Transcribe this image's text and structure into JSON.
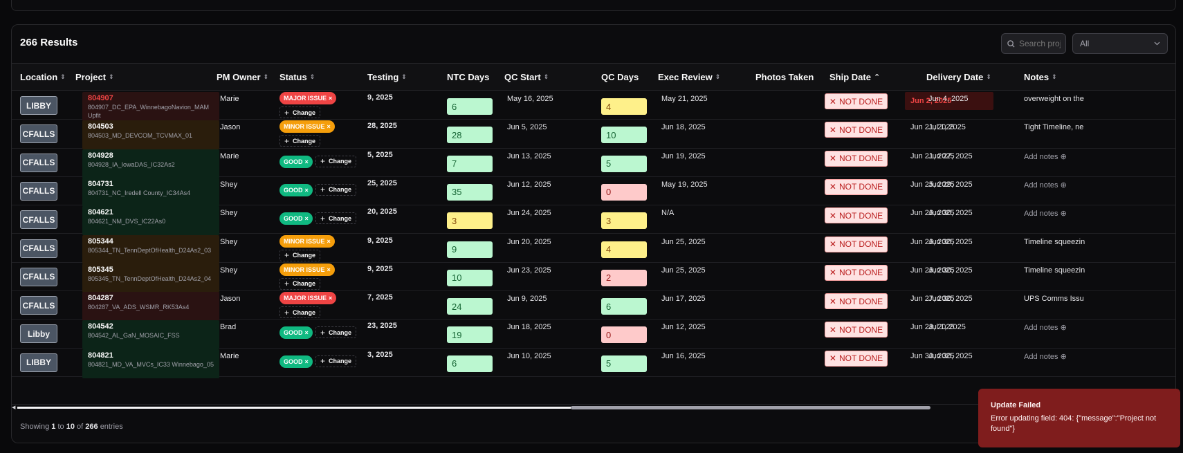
{
  "results_label": "266 Results",
  "search": {
    "placeholder": "Search projects"
  },
  "filter": {
    "value": "All"
  },
  "columns": [
    {
      "label": "Location",
      "sortable": true
    },
    {
      "label": "Project",
      "sortable": true
    },
    {
      "label": "PM Owner",
      "sortable": true
    },
    {
      "label": "Status",
      "sortable": true
    },
    {
      "label": "Testing",
      "sortable": true
    },
    {
      "label": "NTC Days",
      "sortable": false
    },
    {
      "label": "QC Start",
      "sortable": true
    },
    {
      "label": "QC Days",
      "sortable": false
    },
    {
      "label": "Exec Review",
      "sortable": true
    },
    {
      "label": "Photos Taken",
      "sortable": false
    },
    {
      "label": "Ship Date",
      "sortable": true,
      "sorted": "asc"
    },
    {
      "label": "Delivery Date",
      "sortable": true
    },
    {
      "label": "Notes",
      "sortable": true
    }
  ],
  "change_label": "Change",
  "not_done_label": "NOT DONE",
  "add_notes_label": "Add notes",
  "rows": [
    {
      "location": "LIBBY",
      "project_id": "804907",
      "project_name": "804907_DC_EPA_WinnebagoNavion_MAM Upfit",
      "pm": "Marie",
      "status": "MAJOR ISSUE",
      "status_type": "major",
      "testing": "9, 2025",
      "ntc_days": "6",
      "ntc_color": "green",
      "qc_start": "May 16, 2025",
      "qc_days": "4",
      "qc_color": "yellow",
      "exec_review": "May 21, 2025",
      "photos": "NOT DONE",
      "ship_date": "Jun 2, 2025",
      "ship_highlight": true,
      "delivery_date": "Jun 4, 2025",
      "notes": "overweight on the",
      "notes_empty": false
    },
    {
      "location": "CFALLS",
      "project_id": "804503",
      "project_name": "804503_MD_DEVCOM_TCVMAX_01",
      "pm": "Jason",
      "status": "MINOR ISSUE",
      "status_type": "minor",
      "testing": "28, 2025",
      "ntc_days": "28",
      "ntc_color": "green",
      "qc_start": "Jun 5, 2025",
      "qc_days": "10",
      "qc_color": "green",
      "exec_review": "Jun 18, 2025",
      "photos": "NOT DONE",
      "ship_date": "Jun 21, 2025",
      "ship_highlight": false,
      "delivery_date": "Jul 1, 2025",
      "notes": "Tight Timeline, ne",
      "notes_empty": false
    },
    {
      "location": "CFALLS",
      "project_id": "804928",
      "project_name": "804928_IA_IowaDAS_IC32As2",
      "pm": "Marie",
      "status": "GOOD",
      "status_type": "good",
      "testing": "5, 2025",
      "ntc_days": "7",
      "ntc_color": "green",
      "qc_start": "Jun 13, 2025",
      "qc_days": "5",
      "qc_color": "green",
      "exec_review": "Jun 19, 2025",
      "photos": "NOT DONE",
      "ship_date": "Jun 21, 2025",
      "ship_highlight": false,
      "delivery_date": "Jun 27, 2025",
      "notes": "Add notes",
      "notes_empty": true
    },
    {
      "location": "CFALLS",
      "project_id": "804731",
      "project_name": "804731_NC_Iredell County_IC34As4",
      "pm": "Shey",
      "status": "GOOD",
      "status_type": "good",
      "testing": "25, 2025",
      "ntc_days": "35",
      "ntc_color": "green",
      "qc_start": "Jun 12, 2025",
      "qc_days": "0",
      "qc_color": "red",
      "exec_review": "May 19, 2025",
      "photos": "NOT DONE",
      "ship_date": "Jun 25, 2025",
      "ship_highlight": false,
      "delivery_date": "Jun 29, 2025",
      "notes": "Add notes",
      "notes_empty": true
    },
    {
      "location": "CFALLS",
      "project_id": "804621",
      "project_name": "804621_NM_DVS_IC22As0",
      "pm": "Shey",
      "status": "GOOD",
      "status_type": "good",
      "testing": "20, 2025",
      "ntc_days": "3",
      "ntc_color": "yellow",
      "qc_start": "Jun 24, 2025",
      "qc_days": "3",
      "qc_color": "yellow",
      "exec_review": "N/A",
      "photos": "NOT DONE",
      "ship_date": "Jun 26, 2025",
      "ship_highlight": false,
      "delivery_date": "Jun 30, 2025",
      "notes": "Add notes",
      "notes_empty": true
    },
    {
      "location": "CFALLS",
      "project_id": "805344",
      "project_name": "805344_TN_TennDeptOfHealth_D24As2_03",
      "pm": "Shey",
      "status": "MINOR ISSUE",
      "status_type": "minor",
      "testing": "9, 2025",
      "ntc_days": "9",
      "ntc_color": "green",
      "qc_start": "Jun 20, 2025",
      "qc_days": "4",
      "qc_color": "yellow",
      "exec_review": "Jun 25, 2025",
      "photos": "NOT DONE",
      "ship_date": "Jun 26, 2025",
      "ship_highlight": false,
      "delivery_date": "Jun 30, 2025",
      "notes": "Timeline squeezin",
      "notes_empty": false
    },
    {
      "location": "CFALLS",
      "project_id": "805345",
      "project_name": "805345_TN_TennDeptOfHealth_D24As2_04",
      "pm": "Shey",
      "status": "MINOR ISSUE",
      "status_type": "minor",
      "testing": "9, 2025",
      "ntc_days": "10",
      "ntc_color": "green",
      "qc_start": "Jun 23, 2025",
      "qc_days": "2",
      "qc_color": "red",
      "exec_review": "Jun 25, 2025",
      "photos": "NOT DONE",
      "ship_date": "Jun 26, 2025",
      "ship_highlight": false,
      "delivery_date": "Jun 30, 2025",
      "notes": "Timeline squeezin",
      "notes_empty": false
    },
    {
      "location": "CFALLS",
      "project_id": "804287",
      "project_name": "804287_VA_ADS_WSMR_RK53As4",
      "pm": "Jason",
      "status": "MAJOR ISSUE",
      "status_type": "major",
      "testing": "7, 2025",
      "ntc_days": "24",
      "ntc_color": "green",
      "qc_start": "Jun 9, 2025",
      "qc_days": "6",
      "qc_color": "green",
      "exec_review": "Jun 17, 2025",
      "photos": "NOT DONE",
      "ship_date": "Jun 27, 2025",
      "ship_highlight": false,
      "delivery_date": "Jun 30, 2025",
      "notes": "UPS Comms Issu",
      "notes_empty": false
    },
    {
      "location": "Libby",
      "project_id": "804542",
      "project_name": "804542_AL_GaN_MOSAIC_FSS",
      "pm": "Brad",
      "status": "GOOD",
      "status_type": "good",
      "testing": "23, 2025",
      "ntc_days": "19",
      "ntc_color": "green",
      "qc_start": "Jun 18, 2025",
      "qc_days": "0",
      "qc_color": "red",
      "exec_review": "Jun 12, 2025",
      "photos": "NOT DONE",
      "ship_date": "Jun 28, 2025",
      "ship_highlight": false,
      "delivery_date": "Jul 1, 2025",
      "notes": "Add notes",
      "notes_empty": true
    },
    {
      "location": "LIBBY",
      "project_id": "804821",
      "project_name": "804821_MD_VA_MVCs_IC33 Winnebago_05",
      "pm": "Marie",
      "status": "GOOD",
      "status_type": "good",
      "testing": "3, 2025",
      "ntc_days": "6",
      "ntc_color": "green",
      "qc_start": "Jun 10, 2025",
      "qc_days": "5",
      "qc_color": "green",
      "exec_review": "Jun 16, 2025",
      "photos": "NOT DONE",
      "ship_date": "Jun 30, 2025",
      "ship_highlight": false,
      "delivery_date": "Jun 30, 2025",
      "notes": "Add notes",
      "notes_empty": true
    }
  ],
  "footer": {
    "prefix": "Showing",
    "from": "1",
    "to_word": "to",
    "to": "10",
    "of_word": "of",
    "total": "266",
    "suffix": "entries"
  },
  "toast": {
    "title": "Update Failed",
    "message": "Error updating field: 404: {\"message\":\"Project not found\"}"
  },
  "colors": {
    "major": "#ef4444",
    "minor": "#f59e0b",
    "good": "#10b981",
    "toast_bg": "#7f1d1d"
  }
}
